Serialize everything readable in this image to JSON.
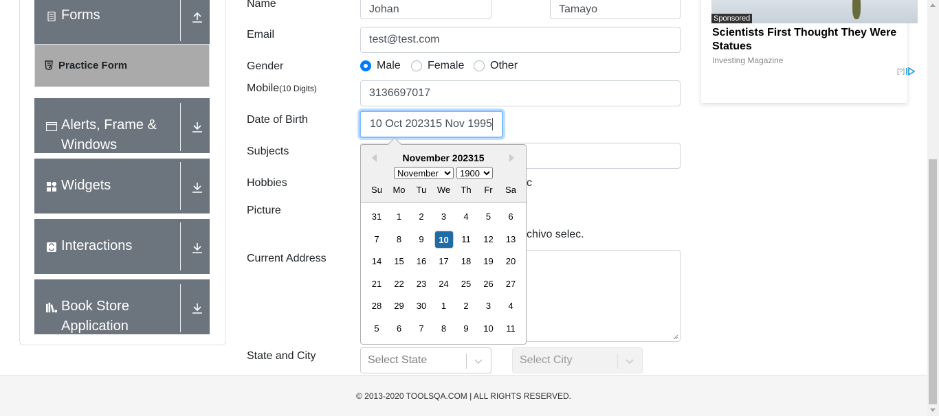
{
  "sidebar": {
    "groups": [
      {
        "title": "Forms",
        "icon": "document-icon",
        "arrow": "upload-arrow"
      },
      {
        "title": "Alerts, Frame & Windows",
        "icon": "window-icon",
        "arrow": "download-arrow"
      },
      {
        "title": "Widgets",
        "icon": "widgets-icon",
        "arrow": "download-arrow"
      },
      {
        "title": "Interactions",
        "icon": "interactions-icon",
        "arrow": "download-arrow"
      },
      {
        "title": "Book Store Application",
        "icon": "books-icon",
        "arrow": "download-arrow"
      }
    ],
    "active_item": "Practice Form"
  },
  "form": {
    "name_label": "Name",
    "first_name": "Johan",
    "last_name": "Tamayo",
    "email_label": "Email",
    "email": "test@test.com",
    "gender_label": "Gender",
    "gender_options": [
      "Male",
      "Female",
      "Other"
    ],
    "gender_selected": "Male",
    "mobile_label": "Mobile",
    "mobile_hint": "(10 Digits)",
    "mobile": "3136697017",
    "dob_label": "Date of Birth",
    "dob_value": "10 Oct 202315 Nov 1995",
    "subjects_label": "Subjects",
    "hobbies_label": "Hobbies",
    "hobbies_partial": "c",
    "picture_label": "Picture",
    "picture_partial": "chivo selec.",
    "address_label": "Current Address",
    "state_city_label": "State and City",
    "state_placeholder": "Select State",
    "city_placeholder": "Select City"
  },
  "datepicker": {
    "title": "November 202315",
    "month_selected": "November",
    "year_selected": "1900",
    "weekdays": [
      "Su",
      "Mo",
      "Tu",
      "We",
      "Th",
      "Fr",
      "Sa"
    ],
    "weeks": [
      [
        "31",
        "1",
        "2",
        "3",
        "4",
        "5",
        "6"
      ],
      [
        "7",
        "8",
        "9",
        "10",
        "11",
        "12",
        "13"
      ],
      [
        "14",
        "15",
        "16",
        "17",
        "18",
        "19",
        "20"
      ],
      [
        "21",
        "22",
        "23",
        "24",
        "25",
        "26",
        "27"
      ],
      [
        "28",
        "29",
        "30",
        "1",
        "2",
        "3",
        "4"
      ],
      [
        "5",
        "6",
        "7",
        "8",
        "9",
        "10",
        "11"
      ]
    ],
    "selected_day": "10"
  },
  "ad": {
    "badge": "Sponsored",
    "headline": "Scientists First Thought They Were Statues",
    "source": "Investing Magazine",
    "help": "[?]"
  },
  "footer": {
    "text": "© 2013-2020 TOOLSQA.COM | ALL RIGHTS RESERVED."
  }
}
